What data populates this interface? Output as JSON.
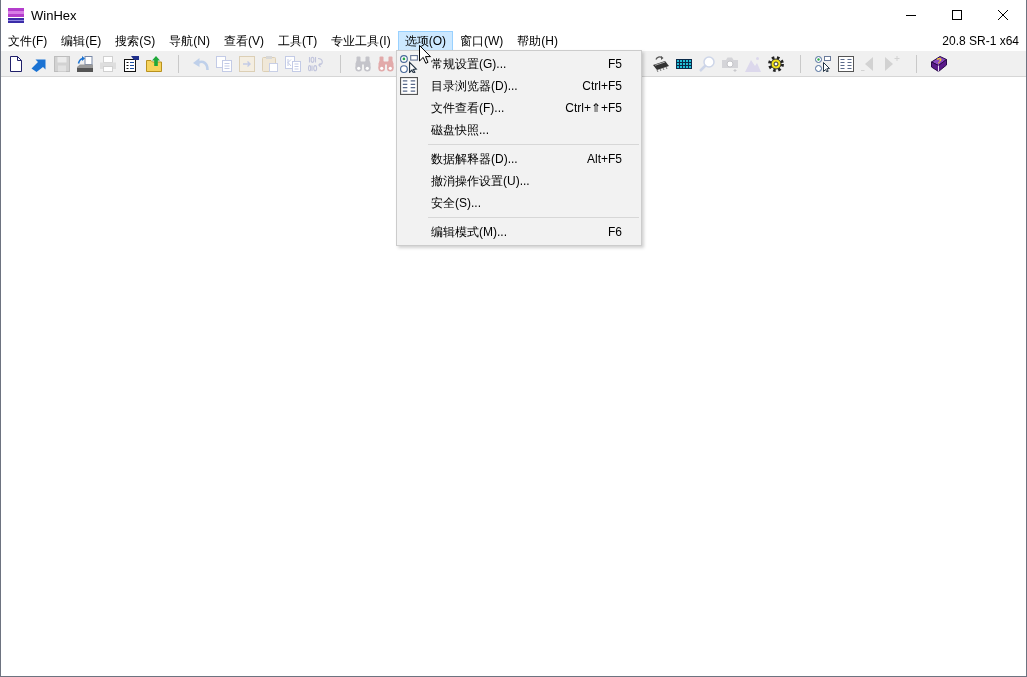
{
  "window": {
    "title": "WinHex"
  },
  "menu_bar": {
    "items": [
      {
        "label": "文件(F)",
        "selected": false
      },
      {
        "label": "编辑(E)",
        "selected": false
      },
      {
        "label": "搜索(S)",
        "selected": false
      },
      {
        "label": "导航(N)",
        "selected": false
      },
      {
        "label": "查看(V)",
        "selected": false
      },
      {
        "label": "工具(T)",
        "selected": false
      },
      {
        "label": "专业工具(I)",
        "selected": false
      },
      {
        "label": "选项(O)",
        "selected": true
      },
      {
        "label": "窗口(W)",
        "selected": false
      },
      {
        "label": "帮助(H)",
        "selected": false
      }
    ],
    "version": "20.8 SR-1 x64"
  },
  "toolbar": {
    "left": [
      [
        {
          "kind": "new-file",
          "disabled": false
        },
        {
          "kind": "open",
          "disabled": false
        },
        {
          "kind": "save",
          "disabled": true
        },
        {
          "kind": "disk",
          "disabled": false
        },
        {
          "kind": "print",
          "disabled": true
        },
        {
          "kind": "properties",
          "disabled": false
        },
        {
          "kind": "folder-up",
          "disabled": false
        }
      ],
      [
        {
          "kind": "undo",
          "disabled": true
        },
        {
          "kind": "copy",
          "disabled": true
        },
        {
          "kind": "paste-new",
          "disabled": true
        },
        {
          "kind": "clipboard",
          "disabled": true
        },
        {
          "kind": "copy-block",
          "disabled": true
        },
        {
          "kind": "binary",
          "disabled": true
        }
      ],
      [
        {
          "kind": "find",
          "disabled": true
        },
        {
          "kind": "replace",
          "disabled": true
        }
      ]
    ],
    "right": [
      [
        {
          "kind": "ram",
          "disabled": false
        },
        {
          "kind": "calculator",
          "disabled": false
        },
        {
          "kind": "magnifier",
          "disabled": true
        },
        {
          "kind": "camera",
          "disabled": true
        },
        {
          "kind": "picture",
          "disabled": true
        },
        {
          "kind": "gear",
          "disabled": false
        }
      ],
      [
        {
          "kind": "settings",
          "disabled": false
        },
        {
          "kind": "directory",
          "disabled": false
        },
        {
          "kind": "back",
          "disabled": true
        },
        {
          "kind": "forward",
          "disabled": true
        }
      ],
      [
        {
          "kind": "help",
          "disabled": false
        }
      ]
    ]
  },
  "dropdown_menu": {
    "sections": [
      [
        {
          "kind": "settings",
          "label": "常规设置(G)...",
          "shortcut": "F5"
        },
        {
          "kind": "directory",
          "label": "目录浏览器(D)...",
          "shortcut": "Ctrl+F5"
        },
        {
          "kind": "plain",
          "label": "文件查看(F)...",
          "shortcut": "Ctrl+⇑+F5"
        },
        {
          "kind": "plain",
          "label": "磁盘快照..."
        }
      ],
      [
        {
          "kind": "plain",
          "label": "数据解释器(D)...",
          "shortcut": "Alt+F5"
        },
        {
          "kind": "plain",
          "label": "撤消操作设置(U)..."
        },
        {
          "kind": "plain",
          "label": "安全(S)..."
        }
      ],
      [
        {
          "kind": "plain",
          "label": "编辑模式(M)...",
          "shortcut": "F6"
        }
      ]
    ]
  }
}
